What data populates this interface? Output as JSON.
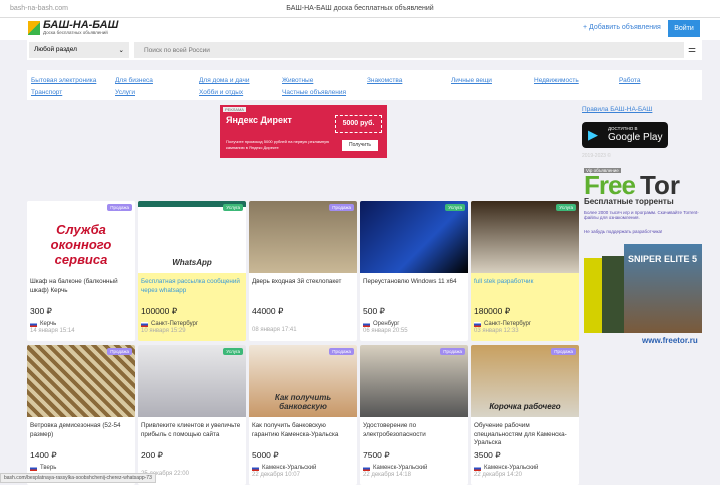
{
  "browser": {
    "url": "bash-na-bash.com",
    "title": "БАШ-НА-БАШ доска бесплатных объявлений"
  },
  "header": {
    "logo_title": "БАШ-НА-БАШ",
    "logo_subtitle": "Доска бесплатных объявлений",
    "add_label": "+ Добавить объявления",
    "login_label": "Войти"
  },
  "search": {
    "section": "Любой раздел",
    "placeholder": "Поиск по всей России"
  },
  "categories": [
    "Бытовая электроника",
    "Для бизнеса",
    "Для дома и дачи",
    "Животные",
    "Знакомства",
    "Личные вещи",
    "Недвижимость",
    "Работа",
    "Транспорт",
    "Услуги",
    "Хобби и отдых",
    "Частные объявления"
  ],
  "ad": {
    "tag": "РЕКЛАМА",
    "brand": "Яндекс Директ",
    "amount": "5000 руб.",
    "text": "Получите промокод 5000 рублей на первую рекламную кампанию в Яндекс Директе",
    "button": "Получить"
  },
  "sidebar": {
    "rules": "Правила БАШ-НА-БАШ",
    "gplay_top": "ДОСТУПНО В",
    "gplay": "Google Play",
    "copyright": "2019-2023 ©",
    "vip": "Vip объявление",
    "freetor_a": "Free",
    "freetor_b": "Tor",
    "freetor_sub": "Бесплатные торренты",
    "freetor_text": "Более 2000 тысяч игр и программ. Скачивайте Torrent-файлы для ознакомления.",
    "freetor_text2": "Не забудь поддержать разработчика!",
    "game": "SNIPER ELITE 5",
    "site": "www.freetor.ru"
  },
  "listings": [
    {
      "title": "Шкаф на балконе (балконный шкаф) Керчь",
      "price": "300 ₽",
      "city": "Керчь",
      "date": "14 января 15:14",
      "badge": "Продажа",
      "img_text": "Служба оконного сервиса",
      "hl": false
    },
    {
      "title": "Бесплатная рассылка сообщений через whatsapp",
      "price": "100000 ₽",
      "city": "Санкт-Петербург",
      "date": "10 января 15:29",
      "badge": "Услуга",
      "img_text": "WhatsApp",
      "hl": true
    },
    {
      "title": "Дверь входная 3й стеклопакет",
      "price": "44000 ₽",
      "city": "",
      "date": "08 января 17:41",
      "badge": "Продажа",
      "img_text": "",
      "hl": false
    },
    {
      "title": "Переустановлю Windows 11 x64",
      "price": "500 ₽",
      "city": "Оренбург",
      "date": "06 января 20:55",
      "badge": "Услуга",
      "img_text": "",
      "hl": false
    },
    {
      "title": "full stek разработчик",
      "price": "180000 ₽",
      "city": "Санкт-Петербург",
      "date": "03 января 12:33",
      "badge": "Услуга",
      "img_text": "",
      "hl": true
    },
    {
      "title": "Ветровка демисезонная (52-54 размер)",
      "price": "1400 ₽",
      "city": "Тверь",
      "date": "",
      "badge": "Продажа",
      "img_text": "",
      "hl": false
    },
    {
      "title": "Привлеките клиентов и увеличьте прибыль с помощью сайта",
      "price": "200 ₽",
      "city": "",
      "date": "25 декабря 22:00",
      "badge": "Услуга",
      "img_text": "",
      "hl": false
    },
    {
      "title": "Как получить банковскую гарантию Каменска-Уральска",
      "price": "5000 ₽",
      "city": "Каменск-Уральский",
      "date": "22 декабря 10:07",
      "badge": "Продажа",
      "img_text": "Как получить банковскую",
      "hl": false
    },
    {
      "title": "Удостоверение по электробезопасности",
      "price": "7500 ₽",
      "city": "Каменск-Уральский",
      "date": "22 декабря 14:18",
      "badge": "Продажа",
      "img_text": "",
      "hl": false
    },
    {
      "title": "Обучение рабочим специальностям для Каменска-Уральска",
      "price": "3500 ₽",
      "city": "Каменск-Уральский",
      "date": "22 декабря 14:20",
      "badge": "Продажа",
      "img_text": "Корочка рабочего",
      "hl": false
    }
  ],
  "statusbar": "bash.com/besplatnaya-rassylka-soobshchenij-cherez-whatsapp-73",
  "colors": {
    "accent": "#2f8fe0",
    "sale": "#a08cf0",
    "service": "#3cb878",
    "highlight": "#fff7a0"
  }
}
